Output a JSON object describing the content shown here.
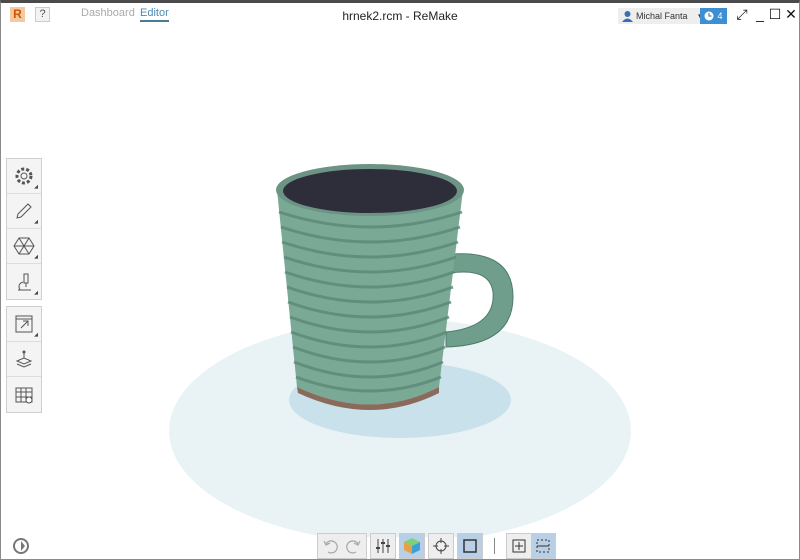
{
  "app": {
    "logo": "R",
    "help": "?",
    "title": "hrnek2.rcm - ReMake"
  },
  "tabs": [
    {
      "label": "Dashboard",
      "active": false
    },
    {
      "label": "Editor",
      "active": true
    }
  ],
  "user": {
    "name": "Michal Fanta",
    "icon": "user-icon"
  },
  "notifications": {
    "count": "4",
    "icon": "clock-icon"
  },
  "window_controls": [
    "expand-icon",
    "minimize-icon",
    "maximize-icon",
    "close-icon"
  ],
  "sidebar_top": [
    "settings-icon",
    "pencil-icon",
    "mesh-icon",
    "microscope-icon"
  ],
  "sidebar_bottom": [
    "export-icon",
    "print-icon",
    "table-icon"
  ],
  "bottom_toolbar": [
    "undo-icon",
    "redo-icon",
    "sliders-icon",
    "cube-icon",
    "crosshair-icon",
    "bounding-box-icon",
    "fit-icon",
    "selection-icon"
  ],
  "colors": {
    "accent": "#3d8fd1",
    "floor": "#e8f2f5",
    "shadow": "#c8e1ea",
    "mug": "#7aa996"
  }
}
